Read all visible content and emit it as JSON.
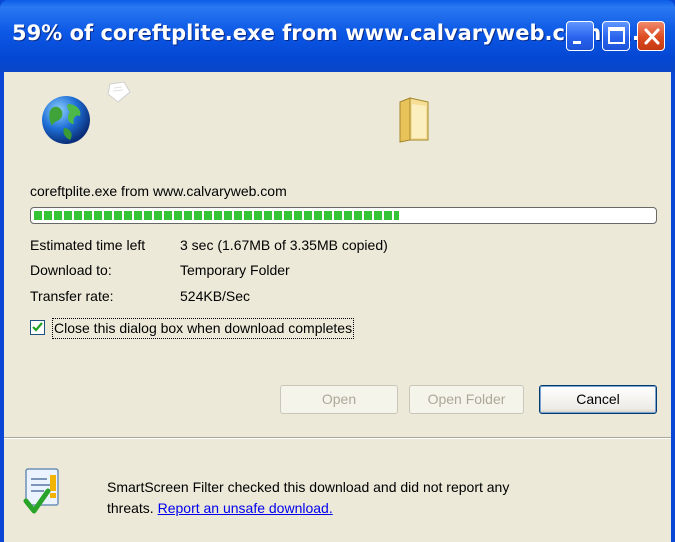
{
  "window": {
    "title": "59% of coreftplite.exe from www.calvaryweb.com C...",
    "accent": "#0a47d6"
  },
  "transfer": {
    "source": "coreftplite.exe from www.calvaryweb.com",
    "progress_fraction": 0.59,
    "estimated_label": "Estimated time left",
    "estimated_value": "3 sec (1.67MB of 3.35MB copied)",
    "download_to_label": "Download to:",
    "download_to_value": "Temporary Folder",
    "rate_label": "Transfer rate:",
    "rate_value": "524KB/Sec"
  },
  "options": {
    "close_when_done_label": "Close this dialog box when download completes",
    "close_when_done_checked": true
  },
  "buttons": {
    "open": "Open",
    "open_folder": "Open Folder",
    "cancel": "Cancel"
  },
  "smartscreen": {
    "message": "SmartScreen Filter checked this download and did not report any",
    "message_end": "threats.",
    "link": "Report an unsafe download."
  },
  "icons": {
    "globe": "globe-icon",
    "paper": "document-icon",
    "folder": "folder-icon",
    "smartscreen": "smartscreen-icon"
  }
}
